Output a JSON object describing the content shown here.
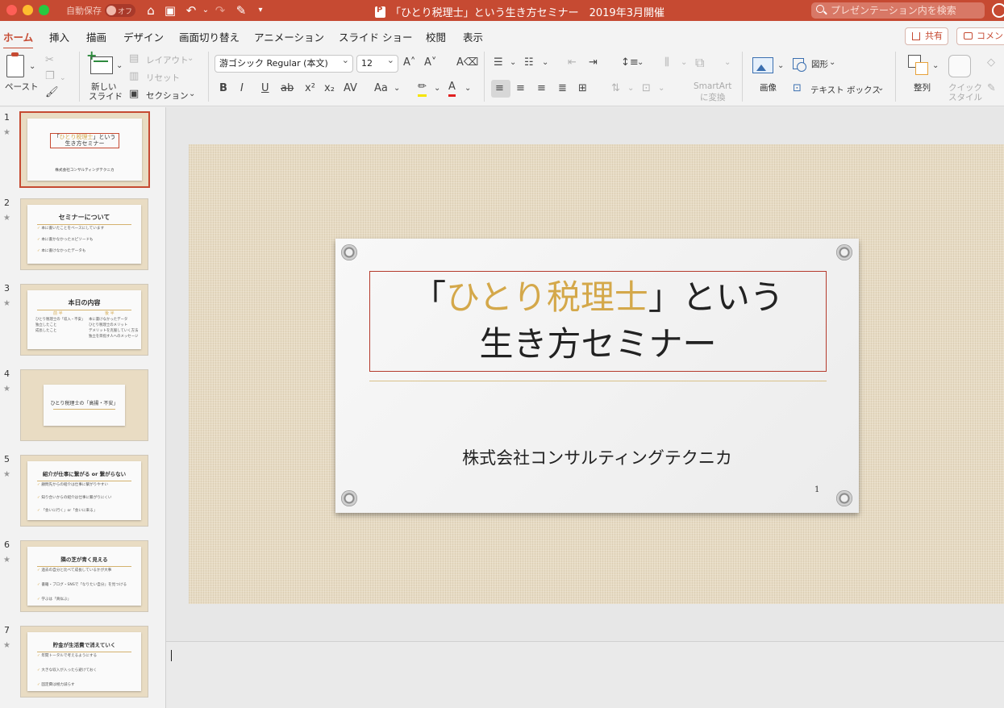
{
  "titlebar": {
    "autosave_label": "自動保存",
    "autosave_state": "オフ",
    "doc_title": "「ひとり税理士」という生き方セミナー　2019年3月開催",
    "search_placeholder": "プレゼンテーション内を検索",
    "accent_color": "#c64a32"
  },
  "tabs": [
    "ホーム",
    "挿入",
    "描画",
    "デザイン",
    "画面切り替え",
    "アニメーション",
    "スライド ショー",
    "校閲",
    "表示"
  ],
  "share_label": "共有",
  "comment_label": "コメント",
  "ribbon": {
    "paste_label": "ペースト",
    "new_slide_label_1": "新しい",
    "new_slide_label_2": "スライド",
    "layout_label": "レイアウト",
    "reset_label": "リセット",
    "section_label": "セクション",
    "font_name": "游ゴシック Regular (本文)",
    "font_size": "12",
    "smartart_label_1": "SmartArt",
    "smartart_label_2": "に変換",
    "picture_label": "画像",
    "shape_label": "図形",
    "textbox_label": "テキスト ボックス",
    "arrange_label": "整列",
    "quick_style_label_1": "クイック",
    "quick_style_label_2": "スタイル"
  },
  "slides": [
    {
      "num": "1",
      "title_pre": "「",
      "title_gold": "ひとり税理士",
      "title_post": "」という",
      "title_line2": "生き方セミナー",
      "company": "株式会社コンサルティングテクニカ"
    },
    {
      "num": "2",
      "title": "セミナーについて",
      "bullets": [
        "本に書いたことをベースにしています",
        "本に書かなかったエピソードも",
        "本に書けなかったデータも"
      ]
    },
    {
      "num": "3",
      "title": "本日の内容",
      "sub_left": "前 半",
      "sub_right": "後 半",
      "left": [
        "ひとり税理士の「収入・不安」",
        "独立したこと",
        "成長したこと"
      ],
      "right": [
        "本に書けなかったデータ",
        "ひとり税理士のメリット",
        "デメリットを克服していく方法",
        "独立を目指す人へのメッセージ"
      ]
    },
    {
      "num": "4",
      "title": "ひとり税理士の「高揚・不安」"
    },
    {
      "num": "5",
      "title": "紹介が仕事に繋がる or 繋がらない",
      "bullets": [
        "顧問先からの紹介は仕事に繋がりやすい",
        "知り合いからの紹介は仕事に繋がりにくい",
        "「会いに行く」or「会いに来る」"
      ]
    },
    {
      "num": "6",
      "title": "隣の芝が青く見える",
      "bullets": [
        "過去の自分と比べて成長しているかが大事",
        "書籍・ブログ・SNSで「なりたい自分」を見つける",
        "学ぶは「真似ぶ」"
      ]
    },
    {
      "num": "7",
      "title": "貯金が生活費で消えていく",
      "bullets": [
        "年間トータルで考えるようにする",
        "大きな収入が入ったら避けておく",
        "固定費は極力減らす"
      ]
    }
  ],
  "main_slide": {
    "title_pre": "「",
    "title_gold": "ひとり税理士",
    "title_post": "」という",
    "title_line2": "生き方セミナー",
    "company": "株式会社コンサルティングテクニカ",
    "page_number": "1",
    "gold_color": "#d4a84a"
  }
}
